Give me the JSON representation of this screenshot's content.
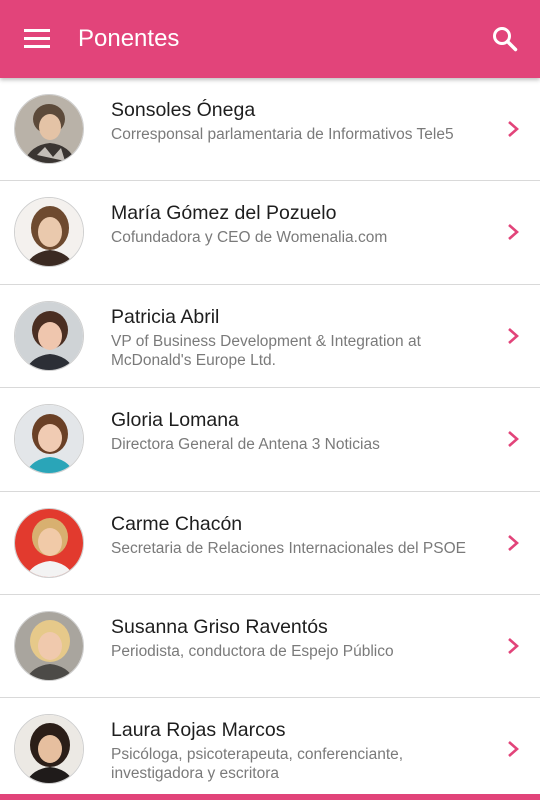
{
  "appbar": {
    "title": "Ponentes",
    "menu_icon": "hamburger-menu-icon",
    "search_icon": "search-icon"
  },
  "colors": {
    "primary": "#e2447a",
    "name_text": "#1e1e1e",
    "role_text": "#7a7a7a",
    "divider": "#d9d9d9"
  },
  "speakers": [
    {
      "name": "Sonsoles Ónega",
      "role": "Corresponsal parlamentaria de Informativos Tele5"
    },
    {
      "name": "María Gómez del Pozuelo",
      "role": "Cofundadora y CEO de Womenalia.com"
    },
    {
      "name": "Patricia Abril",
      "role": "VP of Business Development & Integration at McDonald's Europe Ltd."
    },
    {
      "name": "Gloria Lomana",
      "role": "Directora General de Antena 3 Noticias"
    },
    {
      "name": "Carme Chacón",
      "role": "Secretaria de Relaciones Internacionales del PSOE"
    },
    {
      "name": "Susanna Griso Raventós",
      "role": "Periodista, conductora de Espejo Público"
    },
    {
      "name": "Laura Rojas Marcos",
      "role": "Psicóloga, psicoterapeuta, conferenciante, investigadora y escritora"
    }
  ]
}
